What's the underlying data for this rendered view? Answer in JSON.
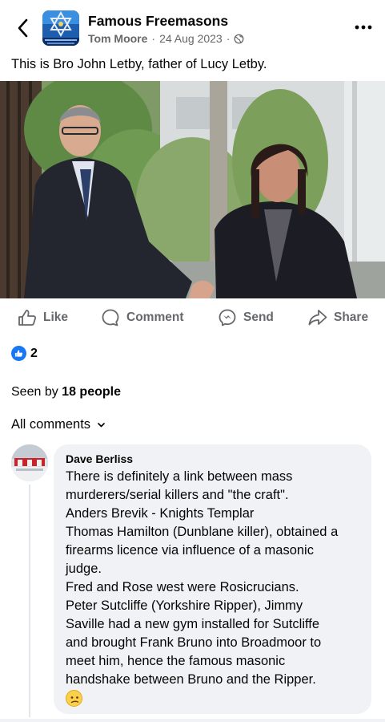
{
  "header": {
    "group_name": "Famous Freemasons",
    "author": "Tom Moore",
    "separator_1": "·",
    "date": "24 Aug 2023",
    "separator_2": "·",
    "audience_icon": "globe-icon"
  },
  "post": {
    "text": "This is Bro John Letby, father of Lucy Letby."
  },
  "actions": [
    {
      "label": "Like",
      "icon": "thumbs-up-icon"
    },
    {
      "label": "Comment",
      "icon": "comment-icon"
    },
    {
      "label": "Send",
      "icon": "messenger-icon"
    },
    {
      "label": "Share",
      "icon": "share-icon"
    }
  ],
  "reactions": {
    "count": "2",
    "icon": "like-reaction-icon",
    "color": "#1877f2"
  },
  "seen": {
    "prefix": "Seen by",
    "count": "18 people"
  },
  "comments_filter": {
    "label": "All comments",
    "icon": "chevron-down-icon"
  },
  "comment": {
    "author": "Dave Berliss",
    "lines": [
      "There is definitely a link between mass",
      "murderers/serial killers and \"the craft\".",
      "Anders Brevik - Knights Templar",
      "Thomas Hamilton (Dunblane killer), obtained a",
      "firearms licence via influence of a masonic",
      "judge.",
      "Fred and Rose west were Rosicrucians.",
      "Peter Sutcliffe (Yorkshire Ripper), Jimmy",
      "Saville had a new gym installed for Sutcliffe",
      "and brought Frank Bruno into Broadmoor to",
      "meet him, hence the famous masonic",
      "handshake between Bruno and the Ripper."
    ],
    "emoji": "confused-face-emoji"
  },
  "colors": {
    "text": "#050505",
    "secondary": "#65676b",
    "bubble": "#f0f2f5",
    "accent": "#1877f2"
  }
}
